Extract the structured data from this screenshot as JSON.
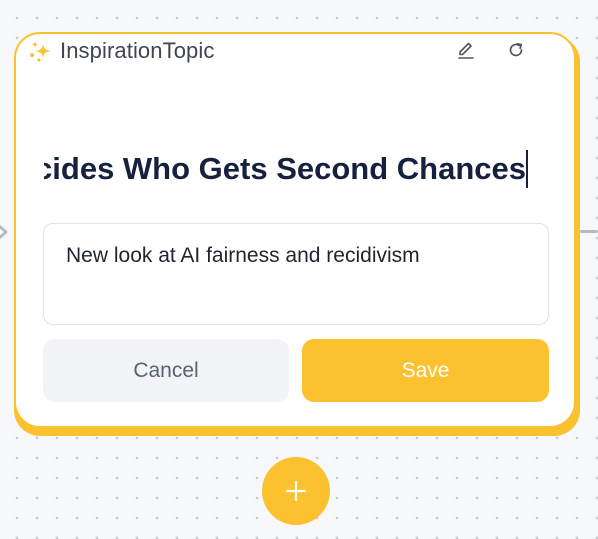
{
  "node": {
    "type_label": "InspirationTopic",
    "title_value": "Algorithm Decides Who Gets Second Chances",
    "description_value": "New look at AI fairness and recidivism",
    "cancel_label": "Cancel",
    "save_label": "Save"
  },
  "icons": {
    "header": "sparkle-icon",
    "edit": "edit-icon",
    "refresh": "refresh-icon",
    "add": "plus-icon",
    "incoming": "arrow-right-icon"
  },
  "colors": {
    "accent": "#fbc12e",
    "title_text": "#16213e",
    "canvas_background": "#f7f8fa"
  }
}
